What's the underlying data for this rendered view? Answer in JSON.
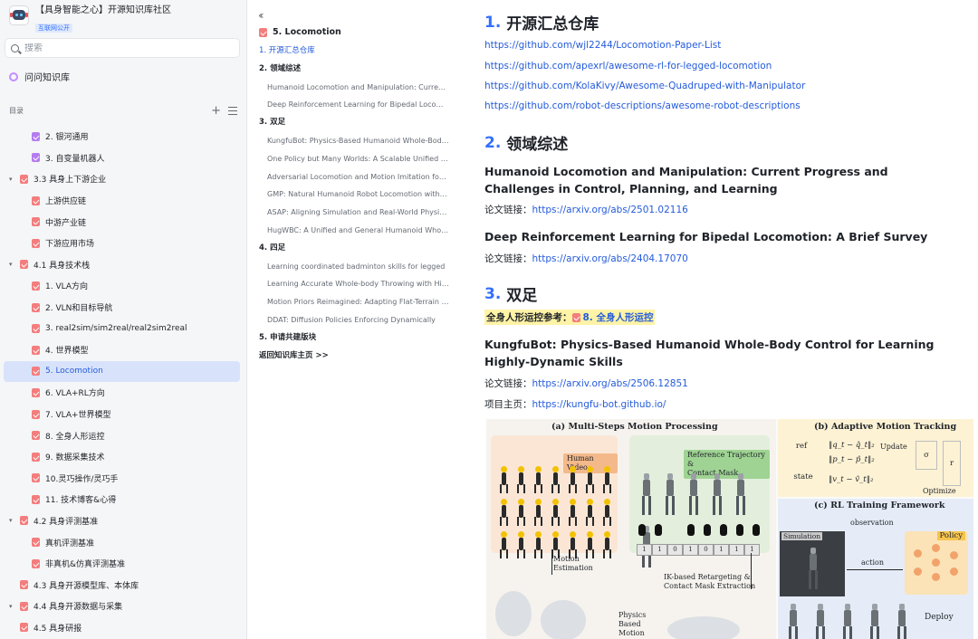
{
  "kb": {
    "title": "【具身智能之心】开源知识库社区",
    "badge": "互联网公开"
  },
  "search": {
    "placeholder": "搜索"
  },
  "ask": {
    "label": "问问知识库"
  },
  "toc": {
    "label": "目录"
  },
  "tree": [
    {
      "label": "2. 银河通用",
      "level": 2,
      "icon": "purple",
      "caret": false
    },
    {
      "label": "3. 自变量机器人",
      "level": 2,
      "icon": "purple",
      "caret": false
    },
    {
      "label": "3.3 具身上下游企业",
      "level": 1,
      "icon": "pink",
      "caret": true
    },
    {
      "label": "上游供应链",
      "level": 2,
      "icon": "pink",
      "caret": false
    },
    {
      "label": "中游产业链",
      "level": 2,
      "icon": "pink",
      "caret": false
    },
    {
      "label": "下游应用市场",
      "level": 2,
      "icon": "pink",
      "caret": false
    },
    {
      "label": "4.1 具身技术栈",
      "level": 1,
      "icon": "pink",
      "caret": true
    },
    {
      "label": "1. VLA方向",
      "level": 2,
      "icon": "pink",
      "caret": false
    },
    {
      "label": "2. VLN和目标导航",
      "level": 2,
      "icon": "pink",
      "caret": false
    },
    {
      "label": "3. real2sim/sim2real/real2sim2real",
      "level": 2,
      "icon": "pink",
      "caret": false
    },
    {
      "label": "4. 世界模型",
      "level": 2,
      "icon": "pink",
      "caret": false
    },
    {
      "label": "5. Locomotion",
      "level": 2,
      "icon": "pink",
      "caret": false,
      "active": true
    },
    {
      "label": "6. VLA+RL方向",
      "level": 2,
      "icon": "pink",
      "caret": false
    },
    {
      "label": "7. VLA+世界模型",
      "level": 2,
      "icon": "pink",
      "caret": false
    },
    {
      "label": "8. 全身人形运控",
      "level": 2,
      "icon": "pink",
      "caret": false
    },
    {
      "label": "9. 数据采集技术",
      "level": 2,
      "icon": "pink",
      "caret": false
    },
    {
      "label": "10.灵巧操作/灵巧手",
      "level": 2,
      "icon": "pink",
      "caret": false
    },
    {
      "label": "11. 技术博客&心得",
      "level": 2,
      "icon": "pink",
      "caret": false
    },
    {
      "label": "4.2 具身评测基准",
      "level": 1,
      "icon": "pink",
      "caret": true
    },
    {
      "label": "真机评测基准",
      "level": 2,
      "icon": "pink",
      "caret": false
    },
    {
      "label": "非真机&仿真评测基准",
      "level": 2,
      "icon": "pink",
      "caret": false
    },
    {
      "label": "4.3 具身开源模型库、本体库",
      "level": 1,
      "icon": "pink",
      "caret": false
    },
    {
      "label": "4.4 具身开源数据与采集",
      "level": 1,
      "icon": "pink",
      "caret": true
    },
    {
      "label": "4.5 具身研报",
      "level": 1,
      "icon": "pink",
      "caret": false
    }
  ],
  "outline": {
    "title": "5. Locomotion",
    "items": [
      {
        "label": "1. 开源汇总仓库",
        "type": "current"
      },
      {
        "label": "2. 领域综述",
        "type": "h"
      },
      {
        "label": "Humanoid Locomotion and Manipulation: Current Progress and Challenges",
        "type": "sub"
      },
      {
        "label": "Deep Reinforcement Learning for Bipedal Locomotion: A Brief Survey",
        "type": "sub"
      },
      {
        "label": "3. 双足",
        "type": "h"
      },
      {
        "label": "KungfuBot: Physics-Based Humanoid Whole-Body Control",
        "type": "sub"
      },
      {
        "label": "One Policy but Many Worlds: A Scalable Unified Policy",
        "type": "sub"
      },
      {
        "label": "Adversarial Locomotion and Motion Imitation for Humanoid",
        "type": "sub"
      },
      {
        "label": "GMP: Natural Humanoid Robot Locomotion with Generative",
        "type": "sub"
      },
      {
        "label": "ASAP: Aligning Simulation and Real-World Physics for",
        "type": "sub"
      },
      {
        "label": "HugWBC: A Unified and General Humanoid Whole-Body",
        "type": "sub"
      },
      {
        "label": "4. 四足",
        "type": "h"
      },
      {
        "label": "Learning coordinated badminton skills for legged",
        "type": "sub"
      },
      {
        "label": "Learning Accurate Whole-body Throwing with High",
        "type": "sub"
      },
      {
        "label": "Motion Priors Reimagined: Adapting Flat-Terrain Skills",
        "type": "sub"
      },
      {
        "label": "DDAT: Diffusion Policies Enforcing Dynamically",
        "type": "sub"
      },
      {
        "label": "5. 申请共建版块",
        "type": "h"
      },
      {
        "label": "返回知识库主页 >>",
        "type": "back"
      }
    ]
  },
  "content": {
    "sec1": {
      "num": "1.",
      "title": "开源汇总仓库"
    },
    "links": [
      "https://github.com/wjl2244/Locomotion-Paper-List",
      "https://github.com/apexrl/awesome-rl-for-legged-locomotion",
      "https://github.com/KolaKivy/Awesome-Quadruped-with-Manipulator",
      "https://github.com/robot-descriptions/awesome-robot-descriptions"
    ],
    "sec2": {
      "num": "2.",
      "title": "领域综述"
    },
    "paper1": {
      "title": "Humanoid Locomotion and Manipulation: Current Progress and Challenges in Control, Planning, and Learning",
      "link_label": "论文链接：",
      "link": "https://arxiv.org/abs/2501.02116"
    },
    "paper2": {
      "title": "Deep Reinforcement Learning for Bipedal Locomotion: A Brief Survey",
      "link_label": "论文链接：",
      "link": "https://arxiv.org/abs/2404.17070"
    },
    "sec3": {
      "num": "3.",
      "title": "双足"
    },
    "ref_note": {
      "prefix": "全身人形运控参考：",
      "mention": "8. 全身人形运控"
    },
    "paper3": {
      "title": "KungfuBot: Physics-Based Humanoid Whole-Body Control for Learning Highly-Dynamic Skills",
      "link_label": "论文链接：",
      "link": "https://arxiv.org/abs/2506.12851",
      "project_label": "项目主页：",
      "project": "https://kungfu-bot.github.io/"
    }
  },
  "figure": {
    "panel_a_title": "(a) Multi-Steps Motion Processing",
    "human_video": "Human Video",
    "ref_traj": "Reference Trajectory &",
    "contact_mask": "Contact Mask",
    "mask_values": [
      "1",
      "1",
      "0",
      "1",
      "0",
      "1",
      "1",
      "1"
    ],
    "motion_est": [
      "Motion",
      "Estimation"
    ],
    "ik_note": [
      "IK-based Retargeting  &",
      "Contact Mask  Extraction"
    ],
    "physics_note": [
      "Physics",
      "Based",
      "Motion"
    ],
    "panel_b_title": "(b) Adaptive Motion Tracking",
    "ref": "ref",
    "state": "state",
    "update": "Update",
    "optimize": "Optimize",
    "sigma": "σ",
    "r": "r",
    "eq1": "‖q_t − q̂_t‖₂",
    "eq2": "‖p_t − p̂_t‖₂",
    "eq3": "‖v_t − v̂_t‖₂",
    "panel_c_title": "(c) RL Training Framework",
    "observation": "observation",
    "action": "action",
    "simulation": "Simulation",
    "policy": "Policy",
    "deploy": "Deploy"
  }
}
